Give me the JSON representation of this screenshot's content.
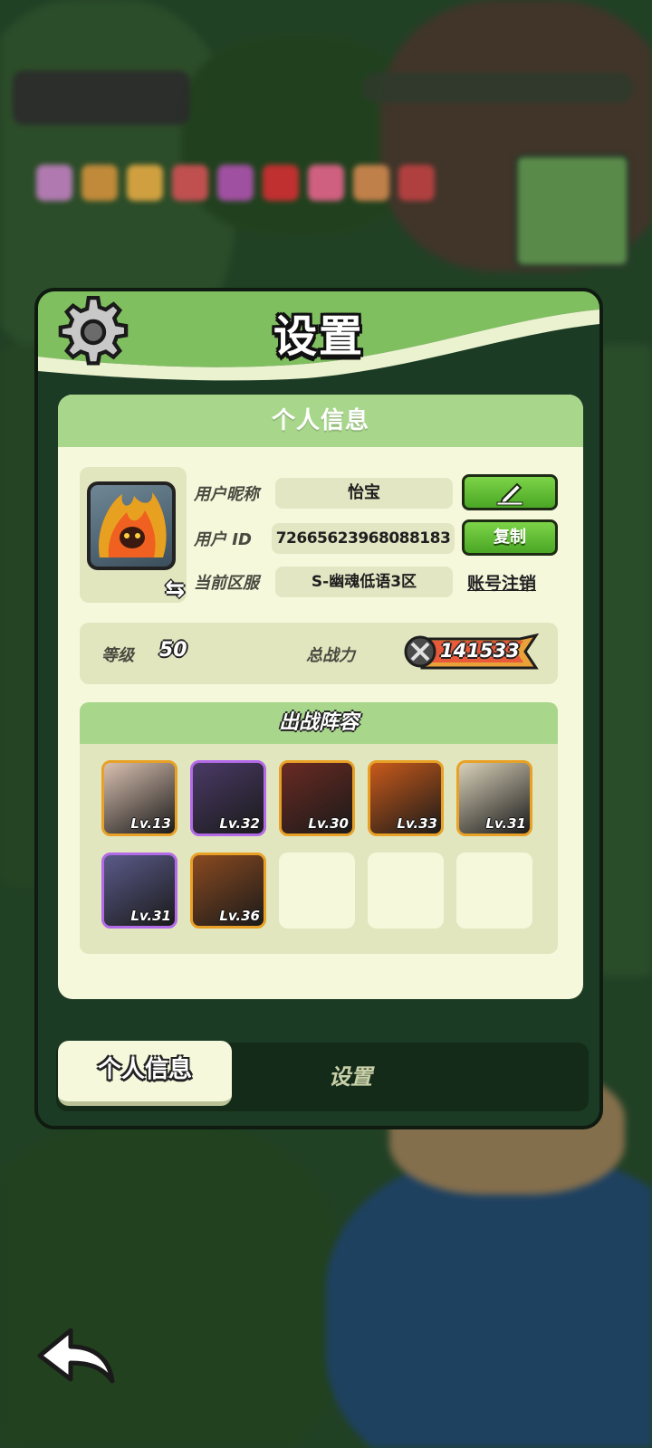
{
  "panel": {
    "title": "设置"
  },
  "card": {
    "header": "个人信息"
  },
  "profile": {
    "nickname_label": "用户昵称",
    "nickname": "怡宝",
    "id_label": "用户 ID",
    "id": "7266562396808818​3",
    "server_label": "当前区服",
    "server": "S-幽魂低语3区",
    "copy_button": "复制",
    "delete_account_link": "账号注销"
  },
  "stats": {
    "level_label": "等级",
    "level": "50",
    "power_label": "总战力",
    "power": "141533"
  },
  "team": {
    "header": "出战阵容",
    "heroes": [
      {
        "level": "Lv.13",
        "rarity": "gold",
        "color": "#d9c0b0"
      },
      {
        "level": "Lv.32",
        "rarity": "purple",
        "color": "#4a3a66"
      },
      {
        "level": "Lv.30",
        "rarity": "gold",
        "color": "#6a2a22"
      },
      {
        "level": "Lv.33",
        "rarity": "gold",
        "color": "#c85a1a"
      },
      {
        "level": "Lv.31",
        "rarity": "gold",
        "color": "#d8d0b8"
      },
      {
        "level": "Lv.31",
        "rarity": "purple",
        "color": "#5a5a8a"
      },
      {
        "level": "Lv.36",
        "rarity": "gold",
        "color": "#8a4a20"
      }
    ],
    "empty_slots": 3
  },
  "tabs": {
    "active": "个人信息",
    "other": "设置"
  },
  "colors": {
    "header_green": "#7fbf5f",
    "card_bg": "#f6f8dc",
    "button_green": "#4aa624",
    "gold_frame": "#e8a126",
    "purple_frame": "#b36ae8"
  }
}
